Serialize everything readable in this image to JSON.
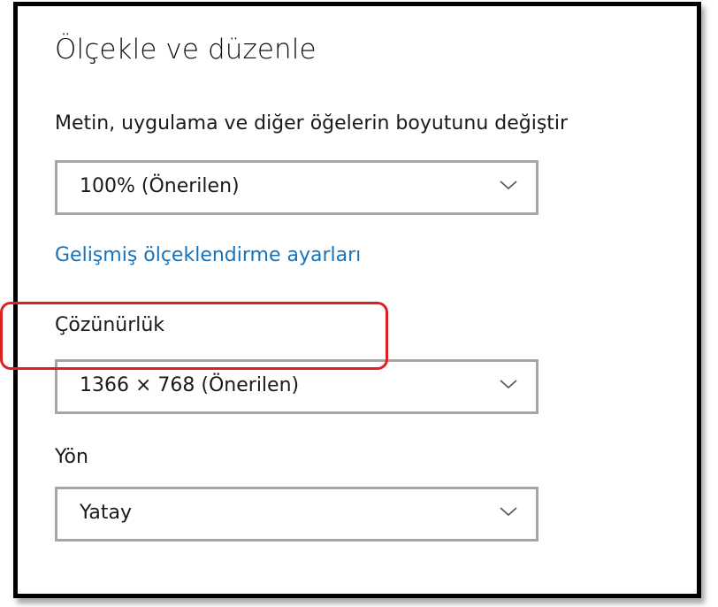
{
  "title": "Ölçekle ve düzenle",
  "scale": {
    "label": "Metin, uygulama ve diğer öğelerin boyutunu değiştir",
    "value": "100% (Önerilen)"
  },
  "advanced_link": "Gelişmiş ölçeklendirme ayarları",
  "resolution": {
    "label": "Çözünürlük",
    "value": "1366 × 768 (Önerilen)"
  },
  "orientation": {
    "label": "Yön",
    "value": "Yatay"
  },
  "colors": {
    "frame": "#000000",
    "link": "#1a73b8",
    "dropdown_border": "#a6a6a6",
    "highlight": "#e02020"
  },
  "icons": {
    "dropdown_arrow": "chevron-down-icon"
  }
}
